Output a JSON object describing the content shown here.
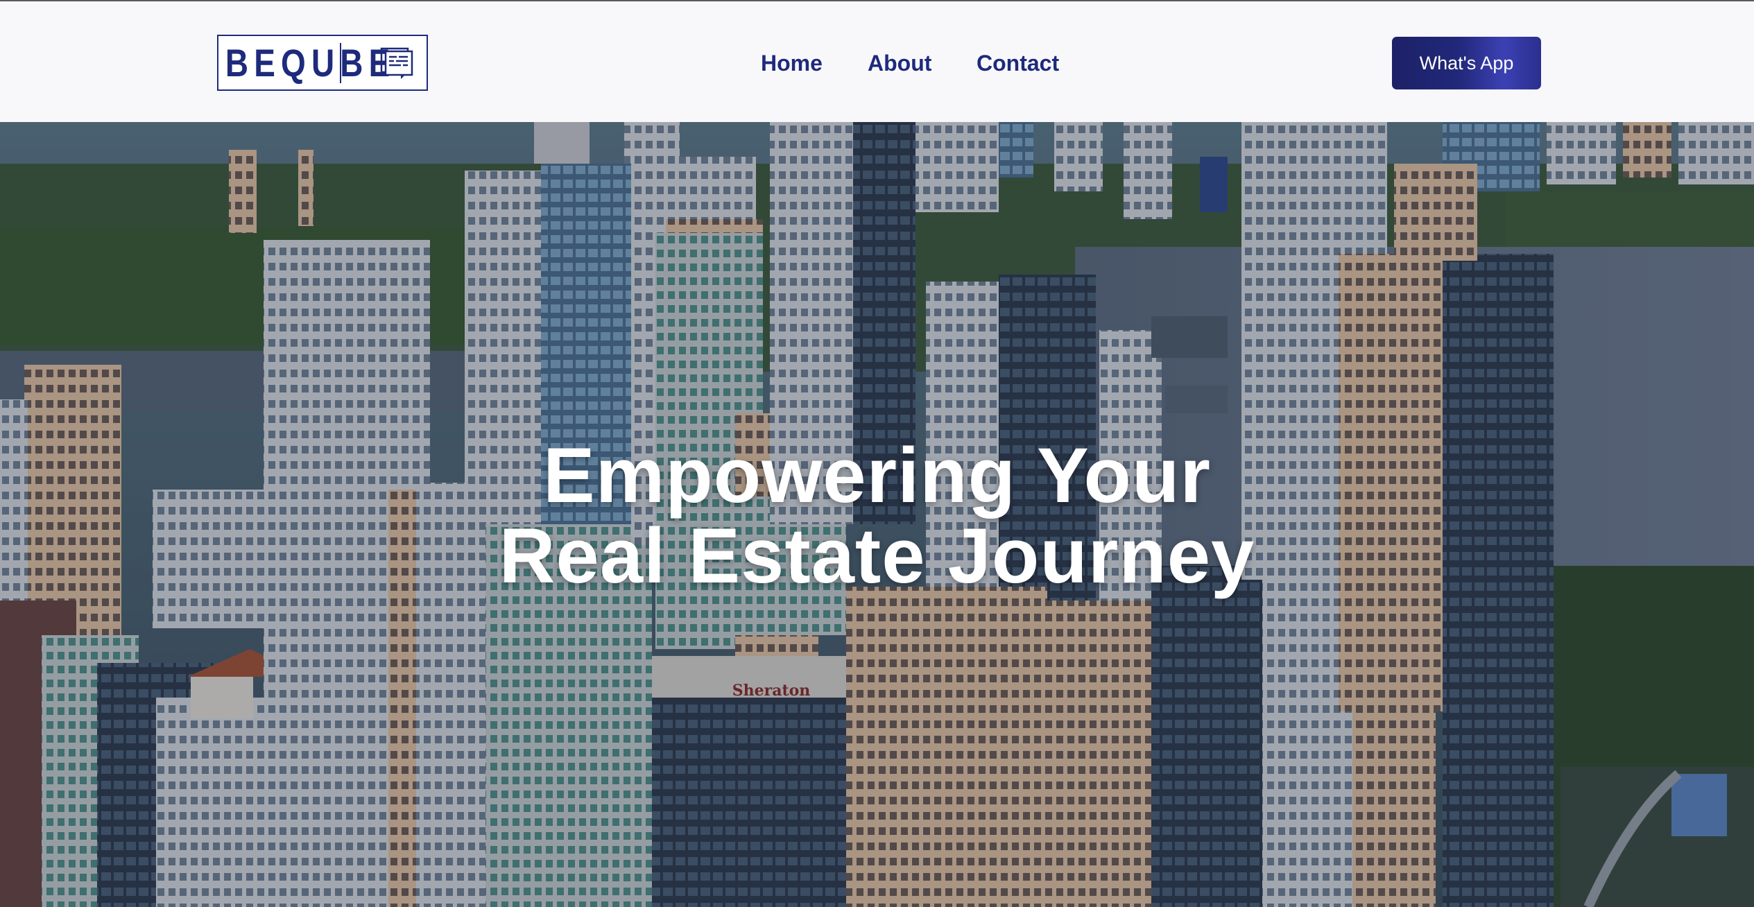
{
  "header": {
    "logo": {
      "text": "BEQUBE",
      "icon": "document-chat-icon",
      "color": "#1e2a7c"
    },
    "nav": [
      {
        "label": "Home"
      },
      {
        "label": "About"
      },
      {
        "label": "Contact"
      }
    ],
    "cta_label": "What's App",
    "accent_color": "#2a2f8e"
  },
  "hero": {
    "title_line1": "Empowering Your",
    "title_line2": "Real Estate Journey",
    "background": "city-skyline-photo",
    "sign_text": "Sheraton"
  }
}
